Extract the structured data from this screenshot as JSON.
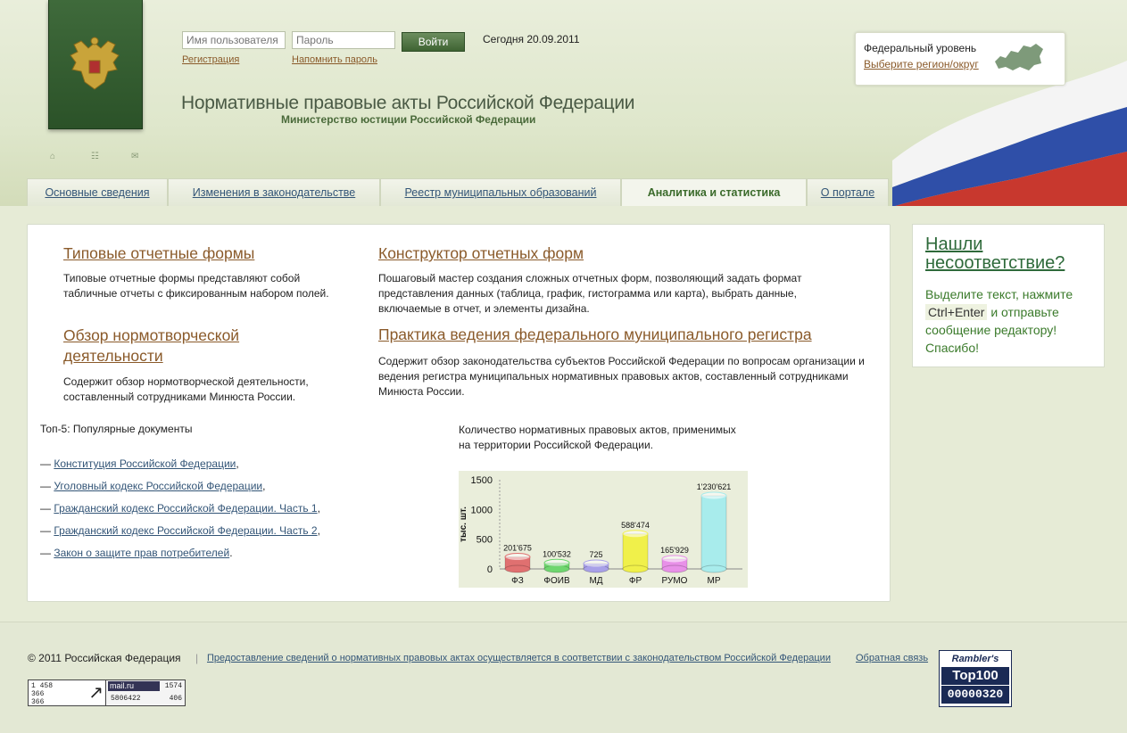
{
  "header": {
    "login": {
      "username_placeholder": "Имя пользователя",
      "password_placeholder": "Пароль",
      "submit_label": "Войти"
    },
    "register_link": "Регистрация",
    "remind_link": "Напомнить пароль",
    "today": "Сегодня 20.09.2011",
    "site_title": "Нормативные правовые акты Российской Федерации",
    "site_subtitle": "Министерство юстиции Российской Федерации",
    "region": {
      "label": "Федеральный уровень",
      "link": "Выберите регион/округ"
    },
    "icons": [
      "home-icon",
      "sitemap-icon",
      "mail-icon"
    ]
  },
  "tabs": [
    {
      "label": "Основные сведения",
      "active": false
    },
    {
      "label": "Изменения в законодательстве",
      "active": false
    },
    {
      "label": "Реестр муниципальных образований",
      "active": false
    },
    {
      "label": "Аналитика и статистика",
      "active": true
    },
    {
      "label": "О портале",
      "active": false
    }
  ],
  "main": {
    "blocks": [
      {
        "title": "Типовые отчетные формы",
        "text": "Типовые отчетные формы представляют собой табличные отчеты с фиксированным набором полей."
      },
      {
        "title": "Конструктор отчетных форм",
        "text": "Пошаговый мастер создания сложных отчетных форм, позволяющий задать формат представления данных (таблица, график, гистограмма или карта), выбрать данные, включаемые в отчет, и элементы дизайна."
      },
      {
        "title": "Обзор нормотворческой деятельности",
        "text": "Содержит обзор нормотворческой деятельности, составленный сотрудниками Минюста России."
      },
      {
        "title": "Практика ведения федерального муниципального регистра",
        "text": "Содержит обзор законодательства субъектов Российской Федерации по вопросам организации и ведения регистра муниципальных нормативных правовых актов, составленный сотрудниками Минюста России."
      }
    ],
    "top5": {
      "title": "Топ-5: Популярные документы",
      "items": [
        {
          "dash": "—",
          "label": "Конституция Российской Федерации",
          "tail": ","
        },
        {
          "dash": "—",
          "label": "Уголовный кодекс Российской Федерации",
          "tail": ","
        },
        {
          "dash": "—",
          "label": "Гражданский кодекс Российской Федерации. Часть 1",
          "tail": ","
        },
        {
          "dash": "—",
          "label": "Гражданский кодекс Российской Федерации. Часть 2",
          "tail": ","
        },
        {
          "dash": "—",
          "label": "Закон о защите прав потребителей",
          "tail": "."
        }
      ]
    },
    "chart_caption": "Количество нормативных правовых актов, применимых на территории Российской Федерации."
  },
  "chart_data": {
    "type": "bar",
    "categories": [
      "ФЗ",
      "ФОИВ",
      "МД",
      "ФР",
      "РУМО",
      "МР"
    ],
    "values": [
      201.675,
      100.532,
      0.725,
      588.474,
      165.929,
      1230.621
    ],
    "value_labels": [
      "201'675",
      "100'532",
      "725",
      "588'474",
      "165'929",
      "1'230'621"
    ],
    "ylabel": "тыс. шт.",
    "ylim": [
      0,
      1500
    ],
    "yticks": [
      0,
      500,
      1000,
      1500
    ],
    "colors": [
      "#e07070",
      "#6fd66f",
      "#a8a0e8",
      "#f0f04a",
      "#e890e8",
      "#a8ecec"
    ]
  },
  "side": {
    "title": "Нашли несоответствие?",
    "text_before": "Выделите текст, нажмите",
    "kbd": "Ctrl+Enter",
    "text_after": "и отправьте сообщение редактору! Спасибо!"
  },
  "footer": {
    "copyright": "© 2011 Российская Федерация",
    "separator": "|",
    "legal_link": "Предоставление сведений о нормативных правовых актах осуществляется в соответствии с законодательством Российской Федерации",
    "feedback_link": "Обратная связь",
    "counter1": [
      "1 458",
      "366",
      "366"
    ],
    "counter2": {
      "brand": "mail.ru",
      "hits": "1574",
      "id": "5806422",
      "hosts": "406"
    },
    "rambler": {
      "line1": "Rambler's",
      "line2": "Top100",
      "line3": "00000320"
    }
  }
}
